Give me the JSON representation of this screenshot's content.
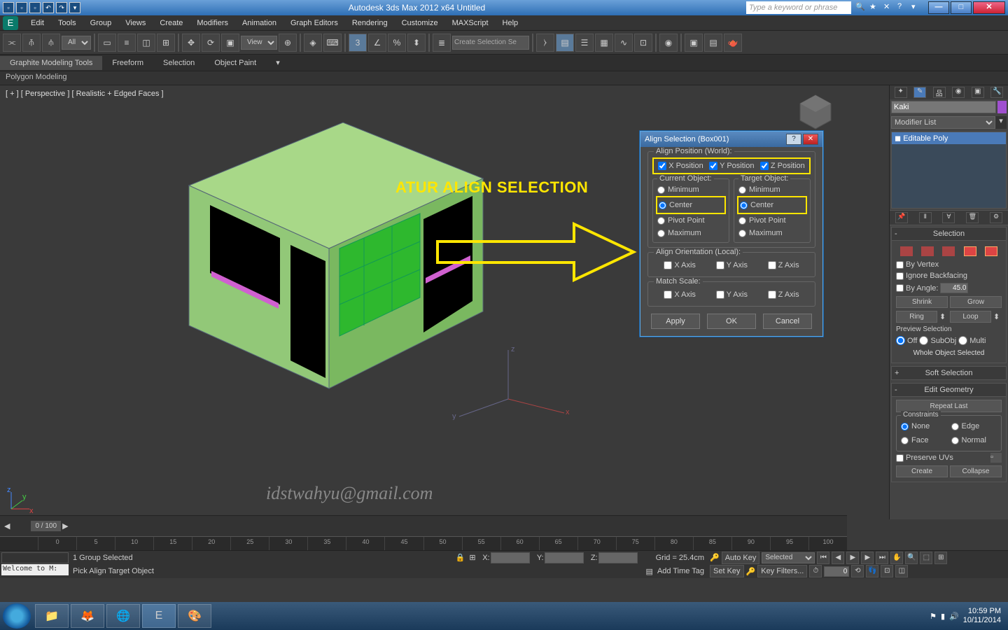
{
  "title_bar": {
    "app_title": "Autodesk 3ds Max 2012 x64   Untitled",
    "search_placeholder": "Type a keyword or phrase"
  },
  "menu": [
    "Edit",
    "Tools",
    "Group",
    "Views",
    "Create",
    "Modifiers",
    "Animation",
    "Graph Editors",
    "Rendering",
    "Customize",
    "MAXScript",
    "Help"
  ],
  "toolbar": {
    "dd_all": "All",
    "dd_view": "View",
    "sel_set": "Create Selection Se"
  },
  "ribbon": {
    "tabs": [
      "Graphite Modeling Tools",
      "Freeform",
      "Selection",
      "Object Paint"
    ],
    "sub": "Polygon Modeling"
  },
  "viewport": {
    "label": "[ + ] [ Perspective ] [ Realistic + Edged Faces ]",
    "annotation": "ATUR ALIGN SELECTION",
    "watermark": "idstwahyu@gmail.com"
  },
  "dialog": {
    "title": "Align Selection (Box001)",
    "align_pos_label": "Align Position (World):",
    "x_pos": "X Position",
    "y_pos": "Y Position",
    "z_pos": "Z Position",
    "current_obj": "Current Object:",
    "target_obj": "Target Object:",
    "opts": [
      "Minimum",
      "Center",
      "Pivot Point",
      "Maximum"
    ],
    "align_orient_label": "Align Orientation (Local):",
    "x_axis": "X Axis",
    "y_axis": "Y Axis",
    "z_axis": "Z Axis",
    "match_scale_label": "Match Scale:",
    "apply": "Apply",
    "ok": "OK",
    "cancel": "Cancel"
  },
  "cmd_panel": {
    "obj_name": "Kaki",
    "mod_list": "Modifier List",
    "mod_item": "Editable Poly",
    "selection": {
      "header": "Selection",
      "by_vertex": "By Vertex",
      "ignore_backfacing": "Ignore Backfacing",
      "by_angle": "By Angle:",
      "angle": "45.0",
      "shrink": "Shrink",
      "grow": "Grow",
      "ring": "Ring",
      "loop": "Loop",
      "preview": "Preview Selection",
      "off": "Off",
      "subobj": "SubObj",
      "multi": "Multi",
      "status": "Whole Object Selected"
    },
    "soft_sel": "Soft Selection",
    "edit_geom": "Edit Geometry",
    "repeat": "Repeat Last",
    "constraints": {
      "label": "Constraints",
      "none": "None",
      "edge": "Edge",
      "face": "Face",
      "normal": "Normal"
    },
    "preserve_uv": "Preserve UVs",
    "create": "Create",
    "collapse": "Collapse"
  },
  "timeline": {
    "frame": "0 / 100",
    "ticks": [
      0,
      5,
      10,
      15,
      20,
      25,
      30,
      35,
      40,
      45,
      50,
      55,
      60,
      65,
      70,
      75,
      80,
      85,
      90,
      95,
      100
    ]
  },
  "status": {
    "welcome": "Welcome to M:",
    "line1": "1 Group Selected",
    "line2": "Pick Align Target Object",
    "grid": "Grid = 25.4cm",
    "add_time_tag": "Add Time Tag",
    "auto_key": "Auto Key",
    "set_key": "Set Key",
    "selected": "Selected",
    "key_filters": "Key Filters..."
  },
  "taskbar": {
    "time": "10:59 PM",
    "date": "10/11/2014"
  }
}
